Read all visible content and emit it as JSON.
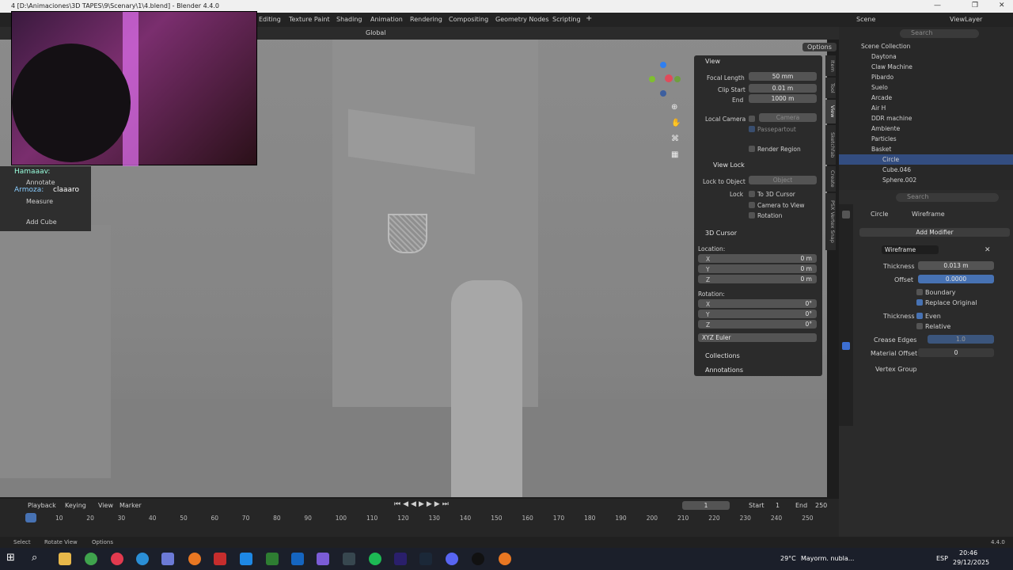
{
  "window": {
    "title": "4 [D:\\Animaciones\\3D TAPES\\9\\Scenary\\1\\4.blend] - Blender 4.4.0"
  },
  "workspaces": [
    "Editing",
    "Texture Paint",
    "Shading",
    "Animation",
    "Rendering",
    "Compositing",
    "Geometry Nodes",
    "Scripting",
    "+"
  ],
  "scene": {
    "label": "Scene",
    "viewlayer": "ViewLayer"
  },
  "viewport_header": {
    "orientation": "Global",
    "options": "Options"
  },
  "overlay_tools": [
    {
      "label": "Annotate"
    },
    {
      "label": "Measure"
    },
    {
      "label": "Add Cube"
    }
  ],
  "chat": [
    {
      "user": "Hamaaav:",
      "msg": ""
    },
    {
      "user": "Armoza:",
      "msg": "claaaro"
    }
  ],
  "npanel": {
    "view_header": "View",
    "focal_label": "Focal Length",
    "focal": "50 mm",
    "clip_start_label": "Clip Start",
    "clip_start": "0.01 m",
    "end_label": "End",
    "end": "1000 m",
    "local_camera_label": "Local Camera",
    "local_camera": "Camera",
    "passepartout": "Passepartout",
    "render_region": "Render Region",
    "view_lock_header": "View Lock",
    "lock_to_object_label": "Lock to Object",
    "lock_to_object": "Object",
    "lock_label": "Lock",
    "to_3d_cursor": "To 3D Cursor",
    "camera_to_view": "Camera to View",
    "rotation_lock": "Rotation",
    "cursor_header": "3D Cursor",
    "location": "Location:",
    "x": "X",
    "y": "Y",
    "z": "Z",
    "lx": "0 m",
    "ly": "0 m",
    "lz": "0 m",
    "rotation": "Rotation:",
    "rx": "0°",
    "ry": "0°",
    "rz": "0°",
    "euler": "XYZ Euler",
    "collections": "Collections",
    "annotations": "Annotations"
  },
  "side_tabs": [
    "Item",
    "Tool",
    "View",
    "Sketchfab",
    "Create",
    "PSX Vertex Snap"
  ],
  "outliner": {
    "search": "Search",
    "items": [
      {
        "name": "Scene Collection"
      },
      {
        "name": "Daytona"
      },
      {
        "name": "Claw Machine"
      },
      {
        "name": "Pibardo"
      },
      {
        "name": "Suelo"
      },
      {
        "name": "Arcade"
      },
      {
        "name": "Air H"
      },
      {
        "name": "DDR machine"
      },
      {
        "name": "Ambiente"
      },
      {
        "name": "Particles"
      },
      {
        "name": "Basket"
      },
      {
        "name": "Circle"
      },
      {
        "name": "Cube.046"
      },
      {
        "name": "Sphere.002"
      }
    ]
  },
  "properties": {
    "search": "Search",
    "object": "Circle",
    "modifier_tab": "Wireframe",
    "add_modifier": "Add Modifier",
    "modifier_name": "Wireframe",
    "thickness_label": "Thickness",
    "thickness": "0.013 m",
    "offset_label": "Offset",
    "offset": "0.0000",
    "boundary": "Boundary",
    "replace_original": "Replace Original",
    "thickness2_label": "Thickness",
    "even": "Even",
    "relative": "Relative",
    "crease_label": "Crease Edges",
    "crease": "1.0",
    "material_offset_label": "Material Offset",
    "material_offset": "0",
    "vertex_group": "Vertex Group"
  },
  "timeline": {
    "menus": [
      "Playback",
      "Keying",
      "View",
      "Marker"
    ],
    "current_frame": "1",
    "start_label": "Start",
    "start": "1",
    "end_label": "End",
    "end": "250",
    "ticks": [
      "1",
      "10",
      "20",
      "30",
      "40",
      "50",
      "60",
      "70",
      "80",
      "90",
      "100",
      "110",
      "120",
      "130",
      "140",
      "150",
      "160",
      "170",
      "180",
      "190",
      "200",
      "210",
      "220",
      "230",
      "240",
      "250"
    ]
  },
  "statusbar": {
    "select": "Select",
    "rotate": "Rotate View",
    "options": "Options",
    "version": "4.4.0"
  },
  "taskbar": {
    "weather_temp": "29°C",
    "weather_desc": "Mayorm. nubla...",
    "lang": "ESP",
    "time": "20:46",
    "date": "29/12/2025"
  }
}
